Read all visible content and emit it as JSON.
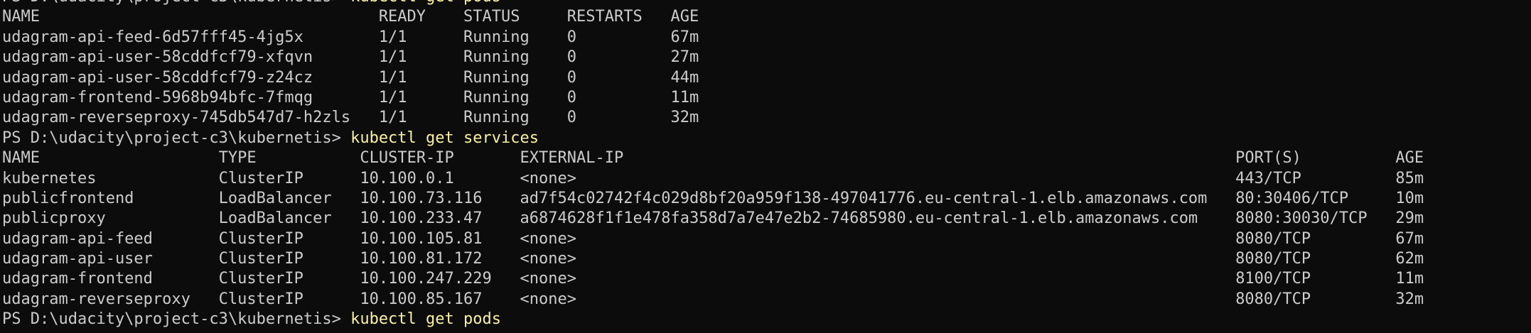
{
  "terminal": {
    "prompt": "PS D:\\udacity\\project-c3\\kubernetis>",
    "commands": {
      "get_pods": "kubectl get pods",
      "get_services": "kubectl get services",
      "partial_next": "kubectl get pods"
    },
    "pods": {
      "headers": [
        "NAME",
        "READY",
        "STATUS",
        "RESTARTS",
        "AGE"
      ],
      "rows": [
        {
          "name": "udagram-api-feed-6d57fff45-4jg5x",
          "ready": "1/1",
          "status": "Running",
          "restarts": "0",
          "age": "67m"
        },
        {
          "name": "udagram-api-user-58cddfcf79-xfqvn",
          "ready": "1/1",
          "status": "Running",
          "restarts": "0",
          "age": "27m"
        },
        {
          "name": "udagram-api-user-58cddfcf79-z24cz",
          "ready": "1/1",
          "status": "Running",
          "restarts": "0",
          "age": "44m"
        },
        {
          "name": "udagram-frontend-5968b94bfc-7fmqg",
          "ready": "1/1",
          "status": "Running",
          "restarts": "0",
          "age": "11m"
        },
        {
          "name": "udagram-reverseproxy-745db547d7-h2zls",
          "ready": "1/1",
          "status": "Running",
          "restarts": "0",
          "age": "32m"
        }
      ]
    },
    "services": {
      "headers": [
        "NAME",
        "TYPE",
        "CLUSTER-IP",
        "EXTERNAL-IP",
        "PORT(S)",
        "AGE"
      ],
      "rows": [
        {
          "name": "kubernetes",
          "type": "ClusterIP",
          "cluster_ip": "10.100.0.1",
          "external_ip": "<none>",
          "ports": "443/TCP",
          "age": "85m"
        },
        {
          "name": "publicfrontend",
          "type": "LoadBalancer",
          "cluster_ip": "10.100.73.116",
          "external_ip": "ad7f54c02742f4c029d8bf20a959f138-497041776.eu-central-1.elb.amazonaws.com",
          "ports": "80:30406/TCP",
          "age": "10m"
        },
        {
          "name": "publicproxy",
          "type": "LoadBalancer",
          "cluster_ip": "10.100.233.47",
          "external_ip": "a6874628f1f1e478fa358d7a7e47e2b2-74685980.eu-central-1.elb.amazonaws.com",
          "ports": "8080:30030/TCP",
          "age": "29m"
        },
        {
          "name": "udagram-api-feed",
          "type": "ClusterIP",
          "cluster_ip": "10.100.105.81",
          "external_ip": "<none>",
          "ports": "8080/TCP",
          "age": "67m"
        },
        {
          "name": "udagram-api-user",
          "type": "ClusterIP",
          "cluster_ip": "10.100.81.172",
          "external_ip": "<none>",
          "ports": "8080/TCP",
          "age": "62m"
        },
        {
          "name": "udagram-frontend",
          "type": "ClusterIP",
          "cluster_ip": "10.100.247.229",
          "external_ip": "<none>",
          "ports": "8100/TCP",
          "age": "11m"
        },
        {
          "name": "udagram-reverseproxy",
          "type": "ClusterIP",
          "cluster_ip": "10.100.85.167",
          "external_ip": "<none>",
          "ports": "8080/TCP",
          "age": "32m"
        }
      ]
    },
    "colors": {
      "background": "#0c0c0c",
      "text": "#cccccc",
      "command": "#f9f1a5"
    }
  }
}
